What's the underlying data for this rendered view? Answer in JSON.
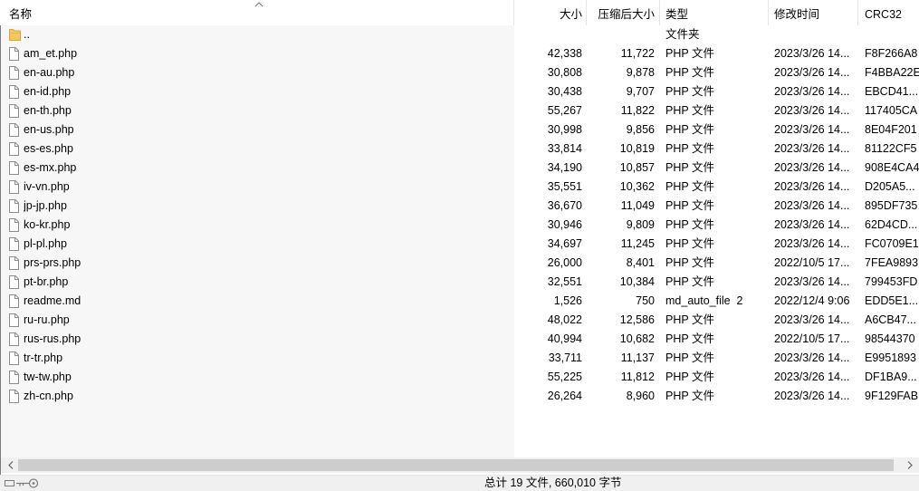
{
  "header": {
    "columns": {
      "name": "名称",
      "size": "大小",
      "packed": "压缩后大小",
      "type": "类型",
      "modified": "修改时间",
      "crc": "CRC32"
    },
    "sort_icon": "chevron-up-icon"
  },
  "rows": [
    {
      "icon": "folder-icon",
      "name": "..",
      "type": "文件夹"
    },
    {
      "icon": "file-icon",
      "name": "am_et.php",
      "size": "42,338",
      "packed": "11,722",
      "type": "PHP 文件",
      "modified": "2023/3/26 14...",
      "crc": "F8F266A8"
    },
    {
      "icon": "file-icon",
      "name": "en-au.php",
      "size": "30,808",
      "packed": "9,878",
      "type": "PHP 文件",
      "modified": "2023/3/26 14...",
      "crc": "F4BBA22E"
    },
    {
      "icon": "file-icon",
      "name": "en-id.php",
      "size": "30,438",
      "packed": "9,707",
      "type": "PHP 文件",
      "modified": "2023/3/26 14...",
      "crc": "EBCD41..."
    },
    {
      "icon": "file-icon",
      "name": "en-th.php",
      "size": "55,267",
      "packed": "11,822",
      "type": "PHP 文件",
      "modified": "2023/3/26 14...",
      "crc": "117405CA"
    },
    {
      "icon": "file-icon",
      "name": "en-us.php",
      "size": "30,998",
      "packed": "9,856",
      "type": "PHP 文件",
      "modified": "2023/3/26 14...",
      "crc": "8E04F201"
    },
    {
      "icon": "file-icon",
      "name": "es-es.php",
      "size": "33,814",
      "packed": "10,819",
      "type": "PHP 文件",
      "modified": "2023/3/26 14...",
      "crc": "81122CF5"
    },
    {
      "icon": "file-icon",
      "name": "es-mx.php",
      "size": "34,190",
      "packed": "10,857",
      "type": "PHP 文件",
      "modified": "2023/3/26 14...",
      "crc": "908E4CA4"
    },
    {
      "icon": "file-icon",
      "name": "iv-vn.php",
      "size": "35,551",
      "packed": "10,362",
      "type": "PHP 文件",
      "modified": "2023/3/26 14...",
      "crc": "D205A5..."
    },
    {
      "icon": "file-icon",
      "name": "jp-jp.php",
      "size": "36,670",
      "packed": "11,049",
      "type": "PHP 文件",
      "modified": "2023/3/26 14...",
      "crc": "895DF735"
    },
    {
      "icon": "file-icon",
      "name": "ko-kr.php",
      "size": "30,946",
      "packed": "9,809",
      "type": "PHP 文件",
      "modified": "2023/3/26 14...",
      "crc": "62D4CD..."
    },
    {
      "icon": "file-icon",
      "name": "pl-pl.php",
      "size": "34,697",
      "packed": "11,245",
      "type": "PHP 文件",
      "modified": "2023/3/26 14...",
      "crc": "FC0709E1"
    },
    {
      "icon": "file-icon",
      "name": "prs-prs.php",
      "size": "26,000",
      "packed": "8,401",
      "type": "PHP 文件",
      "modified": "2022/10/5 17...",
      "crc": "7FEA9893"
    },
    {
      "icon": "file-icon",
      "name": "pt-br.php",
      "size": "32,551",
      "packed": "10,384",
      "type": "PHP 文件",
      "modified": "2023/3/26 14...",
      "crc": "799453FD"
    },
    {
      "icon": "file-icon",
      "name": "readme.md",
      "size": "1,526",
      "packed": "750",
      "type": "md_auto_file  2",
      "modified": "2022/12/4 9:06",
      "crc": "EDD5E1..."
    },
    {
      "icon": "file-icon",
      "name": "ru-ru.php",
      "size": "48,022",
      "packed": "12,586",
      "type": "PHP 文件",
      "modified": "2023/3/26 14...",
      "crc": "A6CB47..."
    },
    {
      "icon": "file-icon",
      "name": "rus-rus.php",
      "size": "40,994",
      "packed": "10,682",
      "type": "PHP 文件",
      "modified": "2022/10/5 17...",
      "crc": "98544370"
    },
    {
      "icon": "file-icon",
      "name": "tr-tr.php",
      "size": "33,711",
      "packed": "11,137",
      "type": "PHP 文件",
      "modified": "2023/3/26 14...",
      "crc": "E9951893"
    },
    {
      "icon": "file-icon",
      "name": "tw-tw.php",
      "size": "55,225",
      "packed": "11,812",
      "type": "PHP 文件",
      "modified": "2023/3/26 14...",
      "crc": "DF1BA9..."
    },
    {
      "icon": "file-icon",
      "name": "zh-cn.php",
      "size": "26,264",
      "packed": "8,960",
      "type": "PHP 文件",
      "modified": "2023/3/26 14...",
      "crc": "9F129FAB"
    }
  ],
  "horizontal_scrollbar": {
    "left_icon": "chevron-left-icon",
    "right_icon": "chevron-right-icon",
    "visible_fraction": 0.99,
    "scroll_fraction": 0
  },
  "status_bar": {
    "icon": "key-icon",
    "summary": "总计 19 文件, 660,010 字节"
  },
  "colors": {
    "text": "#000000",
    "sorted-column-bg": "#f7f7f7",
    "folder": "#f5c75d",
    "folder-edge": "#d9a73a",
    "scroll-thumb": "#cdcdcd",
    "status-bg": "#f0f0f0"
  }
}
